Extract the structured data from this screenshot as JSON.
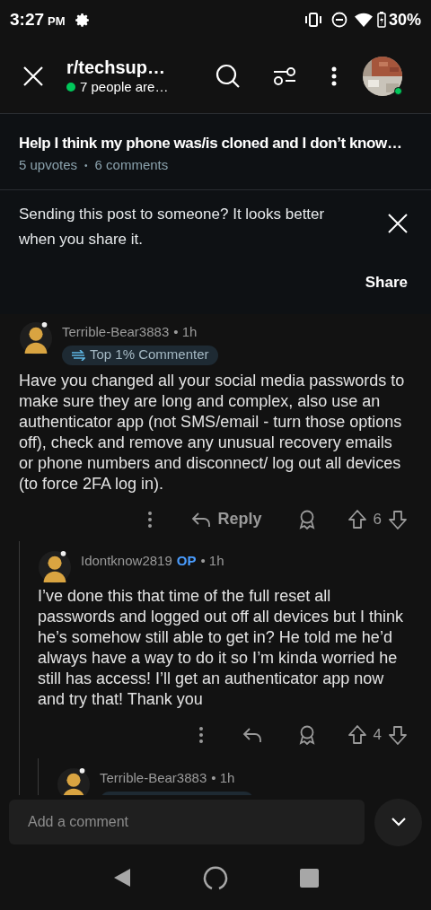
{
  "status_bar": {
    "time": "3:27",
    "ampm": "PM",
    "battery": "30%"
  },
  "header": {
    "title": "r/techsup…",
    "subtitle": "7 people are…",
    "online": true
  },
  "post": {
    "title": "Help I think my phone was/is cloned and I don’t know…",
    "upvotes": "5 upvotes",
    "separator": "•",
    "comments": "6 comments"
  },
  "share_banner": {
    "text": "Sending this post to someone? It looks better when you share it.",
    "button": "Share"
  },
  "comments": [
    {
      "author": "Terrible-Bear3883",
      "time": "• 1h",
      "badge": "Top 1% Commenter",
      "body": "Have you changed all your social media passwords to make sure they are long and complex, also use an authenticator app (not SMS/email - turn those options off), check and remove any unusual recovery emails or phone numbers and disconnect/ log out all devices (to force 2FA log in).",
      "reply": "Reply",
      "votes": "6",
      "children": [
        {
          "author": "Idontknow2819",
          "op": "OP",
          "time": "• 1h",
          "body": "I’ve done this that time of the full reset all passwords and logged out off all devices but I think he’s somehow still able to get in? He told me he’d always have a way to do it so I’m kinda worried he still has access! I’ll get an authenticator app now and try that! Thank you",
          "votes": "4",
          "children": [
            {
              "author": "Terrible-Bear3883",
              "time": "• 1h",
              "badge_clipped": true
            }
          ]
        }
      ]
    }
  ],
  "composer": {
    "placeholder": "Add a comment"
  }
}
